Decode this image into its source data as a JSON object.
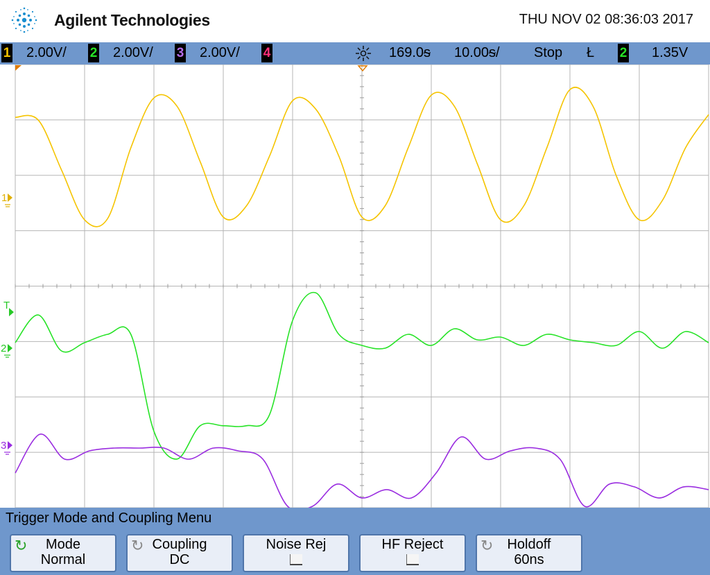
{
  "header": {
    "brand": "Agilent Technologies",
    "datetime": "THU NOV 02 08:36:03 2017"
  },
  "status": {
    "channels": [
      {
        "num": "1",
        "scale": "2.00V/",
        "color": "#f5c400"
      },
      {
        "num": "2",
        "scale": "2.00V/",
        "color": "#27e327"
      },
      {
        "num": "3",
        "scale": "2.00V/",
        "color": "#b36be8"
      },
      {
        "num": "4",
        "scale": "",
        "color": "#ff2e7a"
      }
    ],
    "trigger_icon": "sun-icon",
    "delay": "169.0ᵴ",
    "timebase": "10.00ᵴ/",
    "run_state": "Stop",
    "trigger_edge": "Ł",
    "trigger_source": "2",
    "trigger_level": "1.35V"
  },
  "markers": {
    "ch1": "1",
    "trigger": "T",
    "ch2": "2",
    "ch3": "3"
  },
  "menu": {
    "title": "Trigger Mode and Coupling Menu",
    "softkeys": [
      {
        "label": "Mode",
        "value": "Normal",
        "icon": "cycle-icon"
      },
      {
        "label": "Coupling",
        "value": "DC",
        "icon": "cycle-icon"
      },
      {
        "label": "Noise Rej",
        "value": "",
        "icon": "checkbox"
      },
      {
        "label": "HF Reject",
        "value": "",
        "icon": "checkbox"
      },
      {
        "label": "Holdoff",
        "value": "60ns",
        "icon": "cycle-icon"
      }
    ]
  },
  "colors": {
    "ch1": "#f5c400",
    "ch2": "#27e327",
    "ch3": "#9a2de0",
    "grid": "#b5b5b5",
    "bar": "#6f97cc"
  },
  "chart_data": {
    "type": "line",
    "series": [
      {
        "channel": "1",
        "y": [
          2.9,
          2.8,
          1.0,
          -0.8,
          -0.75,
          1.8,
          3.6,
          3.3,
          1.3,
          -0.7,
          -0.3,
          1.5,
          3.5,
          3.2,
          1.5,
          -0.7,
          -0.3,
          1.8,
          3.7,
          3.3,
          1.2,
          -0.8,
          -0.3,
          1.8,
          3.9,
          3.3,
          0.8,
          -0.8,
          -0.1,
          1.8,
          3.0
        ]
      },
      {
        "channel": "2",
        "y": [
          0.2,
          1.2,
          -0.1,
          0.2,
          0.5,
          0.5,
          -3.0,
          -4.0,
          -2.8,
          -2.8,
          -2.8,
          -2.4,
          1.0,
          2.0,
          0.5,
          0.1,
          0.0,
          0.5,
          0.1,
          0.7,
          0.3,
          0.4,
          0.1,
          0.5,
          0.3,
          0.2,
          0.1,
          0.6,
          0.0,
          0.6,
          0.2
        ]
      },
      {
        "channel": "3",
        "y": [
          -1.0,
          0.4,
          -0.5,
          -0.2,
          -0.1,
          -0.1,
          -0.1,
          -0.5,
          -0.1,
          -0.2,
          -0.5,
          -3.0,
          -4.3,
          -1.4,
          -1.9,
          -1.6,
          -1.9,
          -1.0,
          0.3,
          -0.5,
          -0.2,
          -0.1,
          -0.5,
          -3.6,
          -1.4,
          -1.5,
          -1.9,
          -1.5,
          -1.6
        ]
      }
    ],
    "divisions": {
      "x": 10,
      "y": 8
    }
  }
}
